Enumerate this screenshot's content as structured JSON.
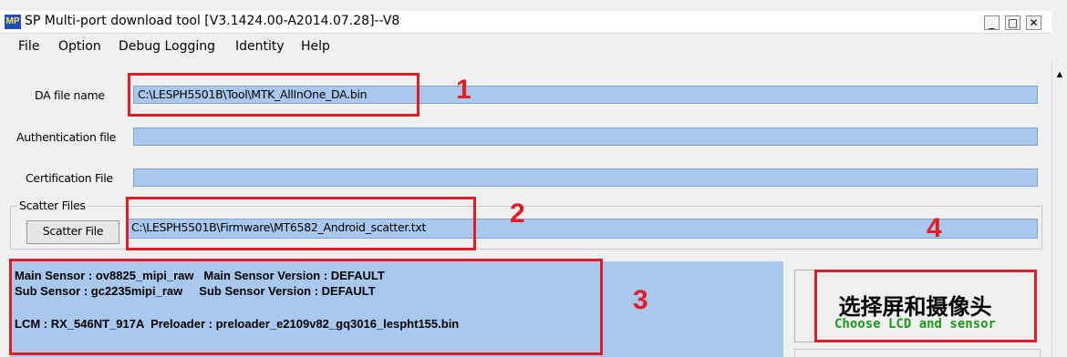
{
  "window": {
    "title": "SP Multi-port download tool [V3.1424.00-A2014.07.28]--V8",
    "icon_text": "MP",
    "controls": {
      "minimize": "_",
      "maximize": "□",
      "close": "✕"
    }
  },
  "menu": [
    "File",
    "Option",
    "Debug Logging",
    "Identity",
    "Help"
  ],
  "fields": {
    "da_label": "DA file name",
    "da_value": "C:\\LESPH5501B\\Tool\\MTK_AllInOne_DA.bin",
    "auth_label": "Authentication file",
    "auth_value": "",
    "cert_label": "Certification File",
    "cert_value": ""
  },
  "scatter": {
    "group_label": "Scatter Files",
    "button_label": "Scatter File",
    "value": "C:\\LESPH5501B\\Firmware\\MT6582_Android_scatter.txt"
  },
  "info": {
    "line1": "Main Sensor : ov8825_mipi_raw   Main Sensor Version : DEFAULT",
    "line2": "Sub Sensor : gc2235mipi_raw     Sub Sensor Version : DEFAULT",
    "line3": "LCM : RX_546NT_917A  Preloader : preloader_e2109v82_gq3016_lespht155.bin"
  },
  "choose_button": {
    "cn": "选择屏和摄像头",
    "en": "Choose LCD and sensor",
    "en_color": "#1a9a1a"
  },
  "annotations": {
    "n1": "1",
    "n2": "2",
    "n3": "3",
    "n4": "4",
    "color": "#e21d25"
  },
  "scrollbar": {
    "up_arrow": "▲"
  }
}
